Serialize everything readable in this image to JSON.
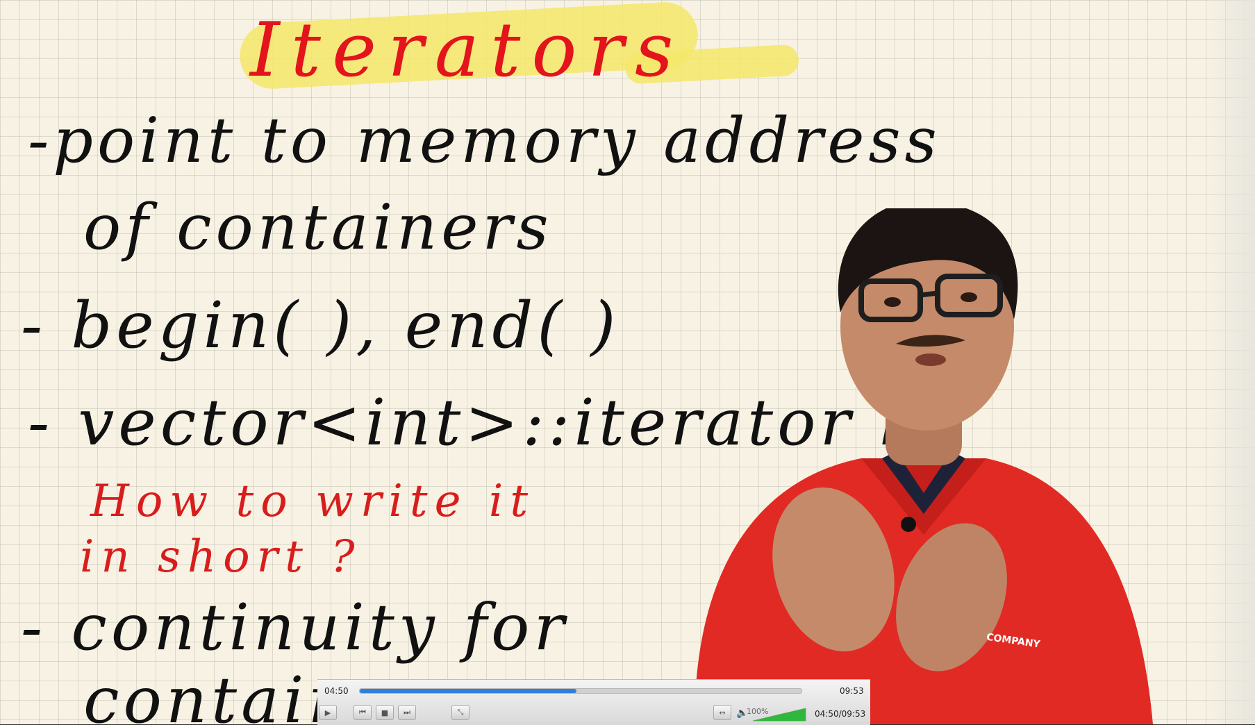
{
  "lecture": {
    "title": "Iterators",
    "lines": [
      "-point to memory address",
      "of containers",
      "- begin( ), end( )",
      "- vector<int>::iterator it;",
      "- continuity for",
      "containers"
    ],
    "red_note": [
      "How to write it",
      "in short ?"
    ],
    "shirt_text": "COMPANY"
  },
  "player": {
    "elapsed": "04:50",
    "duration": "09:53",
    "elapsed_total": "04:50/09:53",
    "progress": 0.49,
    "volume": 1.0,
    "volume_label": "100%",
    "icons": [
      "play-icon",
      "previous-icon",
      "stop-icon",
      "next-icon",
      "fullscreen-icon",
      "resize-icon",
      "speaker-icon"
    ],
    "colors": {
      "progress": "#2f7fdc",
      "volume": "#2fb83c"
    }
  }
}
